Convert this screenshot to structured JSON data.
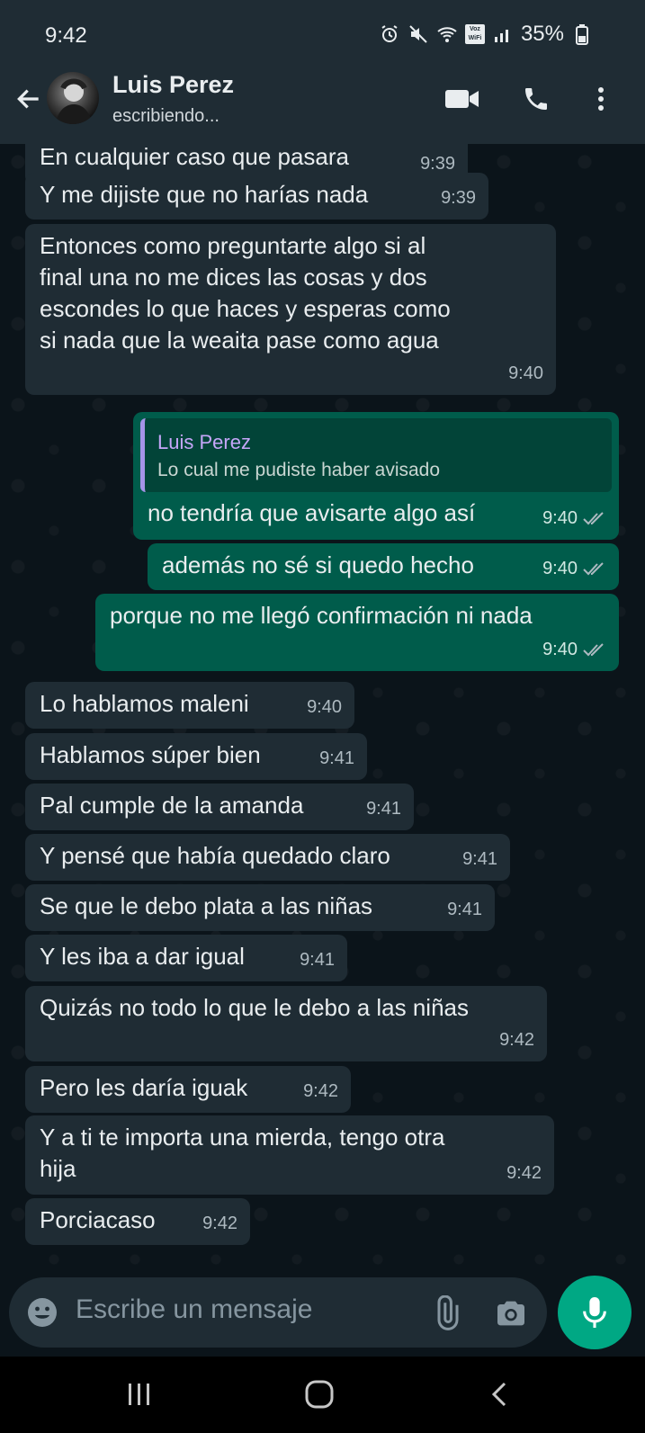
{
  "status_bar": {
    "time": "9:42",
    "battery": "35%",
    "wifi_label": "Voz WiFi"
  },
  "header": {
    "contact_name": "Luis Perez",
    "status": "escribiendo..."
  },
  "messages": [
    {
      "dir": "in",
      "text": "En cualquier caso que pasara",
      "time": "9:39"
    },
    {
      "dir": "in",
      "text": "Y me dijiste que no harías nada",
      "time": "9:39"
    },
    {
      "dir": "in",
      "text": "Entonces como preguntarte algo si al\nfinal una no me dices las cosas y dos\nescondes lo que haces y esperas como\nsi nada que la weaita pase como agua",
      "time": "9:40"
    },
    {
      "dir": "out",
      "quote": {
        "name": "Luis Perez",
        "text": "Lo cual me pudiste haber avisado"
      },
      "text": "no tendría que avisarte algo así",
      "time": "9:40"
    },
    {
      "dir": "out",
      "text": "además no sé si quedo hecho",
      "time": "9:40"
    },
    {
      "dir": "out",
      "text": "porque no me llegó confirmación ni nada",
      "time": "9:40"
    },
    {
      "dir": "in",
      "text": "Lo hablamos maleni",
      "time": "9:40"
    },
    {
      "dir": "in",
      "text": "Hablamos súper bien",
      "time": "9:41"
    },
    {
      "dir": "in",
      "text": "Pal cumple de la amanda",
      "time": "9:41"
    },
    {
      "dir": "in",
      "text": "Y pensé que había quedado claro",
      "time": "9:41"
    },
    {
      "dir": "in",
      "text": "Se que le debo plata a las niñas",
      "time": "9:41"
    },
    {
      "dir": "in",
      "text": "Y les iba a dar igual",
      "time": "9:41"
    },
    {
      "dir": "in",
      "text": "Quizás no todo lo que le debo a las niñas",
      "time": "9:42"
    },
    {
      "dir": "in",
      "text": "Pero les daría iguak",
      "time": "9:42"
    },
    {
      "dir": "in",
      "text": "Y a ti te importa una mierda, tengo otra\nhija",
      "time": "9:42"
    },
    {
      "dir": "in",
      "text": "Porciacaso",
      "time": "9:42"
    }
  ],
  "composer": {
    "placeholder": "Escribe un mensaje"
  },
  "icons": {
    "back": "arrow-left-icon",
    "video": "video-call-icon",
    "call": "phone-icon",
    "menu": "more-vertical-icon",
    "emoji": "emoji-icon",
    "attach": "paperclip-icon",
    "camera": "camera-icon",
    "mic": "microphone-icon"
  },
  "colors": {
    "bg": "#0b141a",
    "bubble_in": "#1f2c34",
    "bubble_out": "#005c4b",
    "accent": "#00a884",
    "quote_name": "#c5a6f8"
  }
}
